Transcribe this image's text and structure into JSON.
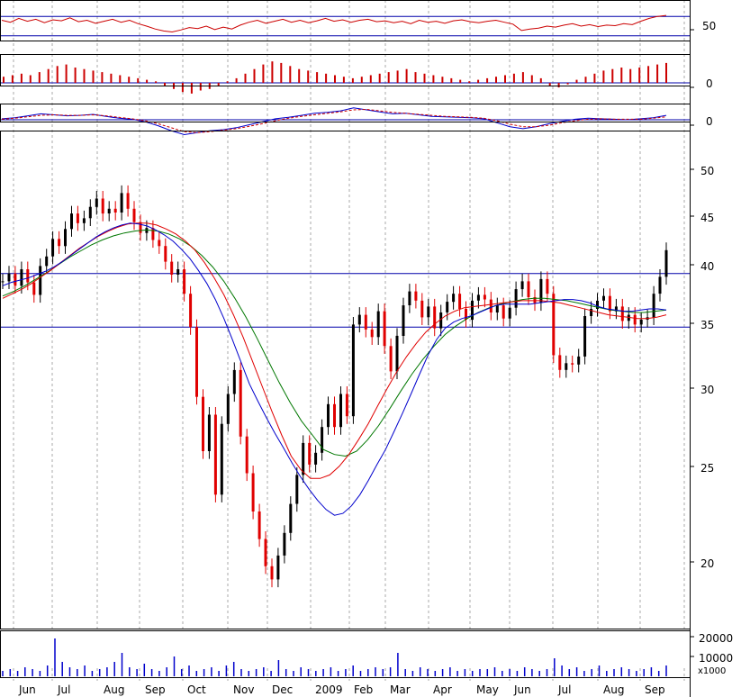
{
  "chart_data": {
    "type": "candlestick-stack",
    "title": "",
    "xlabel": "",
    "ylabel": "",
    "colors": {
      "up_candle": "#000000",
      "down_candle": "#e00000",
      "ma_fast": "#0000cc",
      "ma_mid": "#e00000",
      "ma_slow": "#007700",
      "reference_lines": "#0000aa",
      "indicator_line": "#cc0000",
      "histogram": "#cc0000",
      "volume": "#0000cc",
      "grid": "#aaaaaa"
    },
    "months": [
      "Jun",
      "Jul",
      "Aug",
      "Sep",
      "Oct",
      "Nov",
      "Dec",
      "2009",
      "Feb",
      "Mar",
      "Apr",
      "May",
      "Jun",
      "Jul",
      "Aug",
      "Sep"
    ],
    "price_panel": {
      "scale": "log",
      "ylim": [
        18,
        52
      ],
      "ticks": [
        "50",
        "45",
        "40",
        "35",
        "30",
        "25",
        "20"
      ],
      "reference_levels": [
        39.2,
        34.6
      ],
      "close": [
        38.5,
        39.2,
        38.1,
        39.6,
        38.4,
        37.3,
        39.9,
        40.8,
        42.5,
        41.8,
        43.5,
        45.1,
        44.1,
        44.6,
        45.8,
        46.7,
        45.1,
        45.6,
        45.2,
        47.3,
        45.6,
        44.2,
        43.1,
        43.6,
        42.4,
        41.8,
        40.3,
        39.1,
        39.6,
        37.4,
        34.6,
        29.4,
        25.9,
        28.2,
        23.4,
        27.6,
        29.6,
        31.3,
        26.8,
        24.6,
        22.5,
        21.1,
        19.8,
        19.2,
        20.3,
        21.4,
        22.9,
        24.5,
        26.4,
        25.1,
        25.8,
        27.4,
        28.9,
        27.4,
        29.6,
        28.1,
        34.8,
        35.6,
        34.4,
        33.8,
        35.9,
        33.1,
        31.2,
        33.9,
        36.4,
        37.6,
        36.8,
        35.4,
        36.3,
        34.5,
        35.8,
        36.7,
        37.4,
        36.1,
        35.2,
        36.8,
        37.3,
        36.9,
        35.8,
        36.4,
        35.3,
        36.2,
        37.8,
        38.5,
        37.1,
        36.6,
        38.7,
        37.4,
        32.4,
        31.3,
        31.8,
        31.7,
        32.3,
        35.5,
        36.1,
        36.8,
        37.2,
        35.9,
        36.3,
        35.1,
        35.6,
        34.8,
        35.2,
        35.4,
        37.4,
        38.9,
        41.4
      ],
      "ma_fast": [
        38.1,
        38.4,
        38.6,
        38.8,
        39.1,
        39.4,
        39.8,
        40.3,
        40.9,
        41.5,
        42.1,
        42.7,
        43.2,
        43.6,
        43.9,
        44.1,
        44.0,
        43.8,
        43.4,
        42.9,
        42.3,
        41.5,
        40.6,
        39.5,
        38.3,
        36.9,
        35.3,
        33.6,
        31.9,
        30.3,
        29.1,
        28.0,
        27.0,
        26.1,
        25.2,
        24.4,
        23.7,
        23.1,
        22.6,
        22.3,
        22.4,
        22.8,
        23.4,
        24.2,
        25.1,
        26.0,
        27.1,
        28.3,
        29.6,
        31.0,
        32.4,
        33.6,
        34.5,
        35.0,
        35.3,
        35.5,
        35.8,
        36.1,
        36.4,
        36.5,
        36.5,
        36.5,
        36.5,
        36.6,
        36.7,
        36.8,
        36.9,
        36.9,
        36.8,
        36.6,
        36.3,
        36.1,
        36.0,
        35.9,
        35.9,
        36.0,
        36.1,
        36.1,
        36.0
      ],
      "ma_mid": [
        37.0,
        37.4,
        37.8,
        38.3,
        38.9,
        39.5,
        40.2,
        40.9,
        41.6,
        42.2,
        42.8,
        43.3,
        43.7,
        44.0,
        44.1,
        44.1,
        43.9,
        43.5,
        43.0,
        42.3,
        41.4,
        40.2,
        38.8,
        37.3,
        35.6,
        33.8,
        31.9,
        30.1,
        28.4,
        26.9,
        25.6,
        24.8,
        24.3,
        24.3,
        24.5,
        25.0,
        25.7,
        26.6,
        27.6,
        28.8,
        30.0,
        31.2,
        32.3,
        33.3,
        34.2,
        34.9,
        35.5,
        35.9,
        36.2,
        36.3,
        36.4,
        36.5,
        36.6,
        36.7,
        36.8,
        36.8,
        36.8,
        36.7,
        36.6,
        36.4,
        36.2,
        36.0,
        35.8,
        35.6,
        35.5,
        35.4,
        35.3,
        35.3,
        35.4,
        35.6
      ],
      "ma_slow": [
        37.2,
        37.6,
        38.1,
        38.7,
        39.3,
        40.0,
        40.7,
        41.3,
        41.9,
        42.4,
        42.8,
        43.1,
        43.3,
        43.4,
        43.3,
        43.0,
        42.5,
        41.8,
        40.9,
        39.8,
        38.5,
        37.0,
        35.4,
        33.7,
        32.0,
        30.4,
        29.0,
        27.8,
        26.9,
        26.0,
        25.7,
        25.6,
        25.9,
        26.6,
        27.5,
        28.6,
        29.8,
        31.0,
        32.1,
        33.1,
        34.0,
        34.7,
        35.3,
        35.8,
        36.2,
        36.5,
        36.7,
        36.9,
        37.0,
        37.0,
        36.9,
        36.8,
        36.6,
        36.4,
        36.2,
        36.0,
        35.9,
        35.8,
        35.8,
        35.9,
        36.0
      ]
    },
    "osc_panel": {
      "tick": "50",
      "reference_levels": [
        70,
        30
      ],
      "values": [
        62,
        58,
        66,
        60,
        64,
        57,
        63,
        61,
        67,
        59,
        62,
        56,
        60,
        64,
        58,
        62,
        55,
        50,
        44,
        40,
        38,
        42,
        47,
        45,
        50,
        43,
        48,
        44,
        52,
        58,
        62,
        56,
        60,
        64,
        58,
        62,
        57,
        61,
        66,
        60,
        63,
        58,
        62,
        64,
        59,
        61,
        57,
        60,
        55,
        62,
        58,
        60,
        56,
        61,
        63,
        59,
        57,
        60,
        62,
        58,
        54,
        41,
        44,
        46,
        50,
        48,
        52,
        55,
        50,
        53,
        49,
        52,
        51,
        55,
        53,
        60,
        66,
        70,
        72
      ]
    },
    "hist_panel": {
      "tick": "0",
      "values": [
        4,
        5,
        6,
        5,
        7,
        9,
        11,
        12,
        10,
        9,
        8,
        7,
        6,
        5,
        4,
        3,
        2,
        1,
        -2,
        -4,
        -6,
        -7,
        -5,
        -4,
        -2,
        1,
        3,
        6,
        9,
        12,
        14,
        13,
        11,
        9,
        8,
        7,
        6,
        5,
        4,
        3,
        4,
        5,
        6,
        7,
        8,
        9,
        7,
        6,
        5,
        4,
        3,
        2,
        1,
        2,
        3,
        4,
        5,
        6,
        7,
        5,
        3,
        -2,
        -3,
        -1,
        2,
        4,
        6,
        8,
        9,
        10,
        9,
        10,
        11,
        12,
        13
      ]
    },
    "macd_panel": {
      "tick": "0",
      "line": [
        0.2,
        0.4,
        0.8,
        1.2,
        1.0,
        0.8,
        0.9,
        1.1,
        0.7,
        0.3,
        0.1,
        -0.4,
        -1.2,
        -2.2,
        -3.0,
        -2.6,
        -2.2,
        -2.0,
        -1.6,
        -1.0,
        -0.4,
        0.2,
        0.5,
        0.9,
        1.3,
        1.5,
        1.8,
        2.4,
        2.0,
        1.6,
        1.2,
        1.3,
        1.0,
        0.7,
        0.6,
        0.5,
        0.4,
        0.2,
        -0.6,
        -1.4,
        -1.8,
        -1.4,
        -0.8,
        -0.3,
        0.1,
        0.3,
        0.2,
        0.1,
        0.0,
        0.2,
        0.4,
        0.9
      ],
      "signal": [
        0.1,
        0.3,
        0.6,
        0.9,
        1.0,
        0.9,
        0.9,
        1.0,
        0.8,
        0.5,
        0.2,
        -0.2,
        -0.8,
        -1.6,
        -2.4,
        -2.6,
        -2.4,
        -2.1,
        -1.8,
        -1.3,
        -0.8,
        -0.2,
        0.3,
        0.7,
        1.0,
        1.3,
        1.6,
        2.0,
        2.1,
        1.8,
        1.5,
        1.3,
        1.1,
        0.9,
        0.7,
        0.6,
        0.5,
        0.3,
        -0.2,
        -0.9,
        -1.4,
        -1.4,
        -1.1,
        -0.6,
        -0.2,
        0.1,
        0.2,
        0.1,
        0.1,
        0.1,
        0.3,
        0.6
      ]
    },
    "volume_panel": {
      "ticks": [
        "20000",
        "10000"
      ],
      "unit_label": "x1000",
      "values": [
        3,
        4,
        3,
        5,
        4,
        3,
        6,
        21,
        8,
        5,
        4,
        6,
        3,
        4,
        5,
        8,
        13,
        5,
        4,
        7,
        4,
        3,
        5,
        11,
        4,
        6,
        3,
        4,
        5,
        3,
        6,
        8,
        4,
        3,
        4,
        5,
        3,
        9,
        4,
        3,
        5,
        4,
        3,
        4,
        5,
        3,
        4,
        6,
        3,
        4,
        5,
        4,
        5,
        13,
        4,
        3,
        5,
        4,
        3,
        4,
        5,
        3,
        4,
        3,
        4,
        4,
        5,
        3,
        4,
        3,
        5,
        4,
        3,
        4,
        10,
        6,
        4,
        5,
        3,
        4,
        6,
        3,
        4,
        5,
        4,
        3,
        4,
        5,
        3,
        6
      ]
    }
  }
}
